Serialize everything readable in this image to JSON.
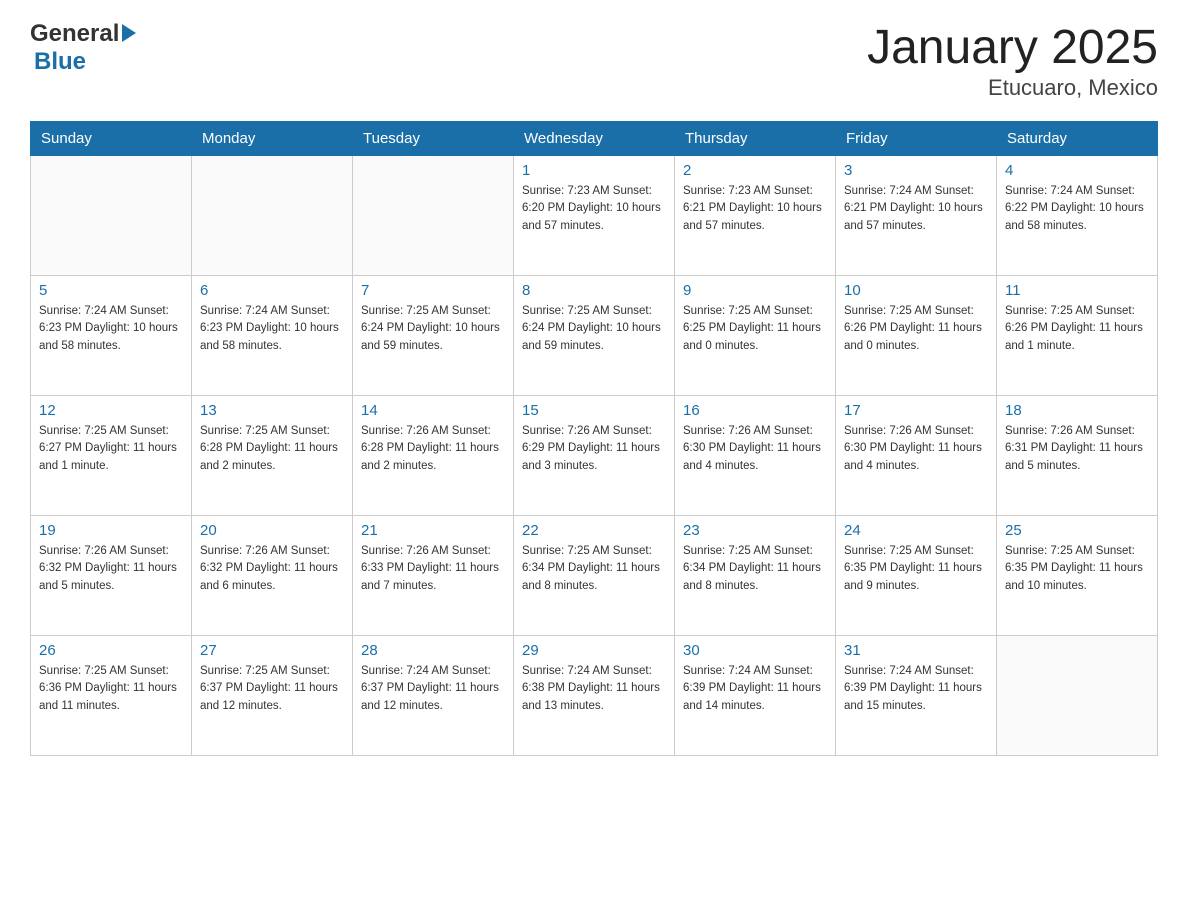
{
  "header": {
    "logo_general": "General",
    "logo_blue": "Blue",
    "title": "January 2025",
    "subtitle": "Etucuaro, Mexico"
  },
  "days_of_week": [
    "Sunday",
    "Monday",
    "Tuesday",
    "Wednesday",
    "Thursday",
    "Friday",
    "Saturday"
  ],
  "weeks": [
    [
      {
        "day": "",
        "info": ""
      },
      {
        "day": "",
        "info": ""
      },
      {
        "day": "",
        "info": ""
      },
      {
        "day": "1",
        "info": "Sunrise: 7:23 AM\nSunset: 6:20 PM\nDaylight: 10 hours and 57 minutes."
      },
      {
        "day": "2",
        "info": "Sunrise: 7:23 AM\nSunset: 6:21 PM\nDaylight: 10 hours and 57 minutes."
      },
      {
        "day": "3",
        "info": "Sunrise: 7:24 AM\nSunset: 6:21 PM\nDaylight: 10 hours and 57 minutes."
      },
      {
        "day": "4",
        "info": "Sunrise: 7:24 AM\nSunset: 6:22 PM\nDaylight: 10 hours and 58 minutes."
      }
    ],
    [
      {
        "day": "5",
        "info": "Sunrise: 7:24 AM\nSunset: 6:23 PM\nDaylight: 10 hours and 58 minutes."
      },
      {
        "day": "6",
        "info": "Sunrise: 7:24 AM\nSunset: 6:23 PM\nDaylight: 10 hours and 58 minutes."
      },
      {
        "day": "7",
        "info": "Sunrise: 7:25 AM\nSunset: 6:24 PM\nDaylight: 10 hours and 59 minutes."
      },
      {
        "day": "8",
        "info": "Sunrise: 7:25 AM\nSunset: 6:24 PM\nDaylight: 10 hours and 59 minutes."
      },
      {
        "day": "9",
        "info": "Sunrise: 7:25 AM\nSunset: 6:25 PM\nDaylight: 11 hours and 0 minutes."
      },
      {
        "day": "10",
        "info": "Sunrise: 7:25 AM\nSunset: 6:26 PM\nDaylight: 11 hours and 0 minutes."
      },
      {
        "day": "11",
        "info": "Sunrise: 7:25 AM\nSunset: 6:26 PM\nDaylight: 11 hours and 1 minute."
      }
    ],
    [
      {
        "day": "12",
        "info": "Sunrise: 7:25 AM\nSunset: 6:27 PM\nDaylight: 11 hours and 1 minute."
      },
      {
        "day": "13",
        "info": "Sunrise: 7:25 AM\nSunset: 6:28 PM\nDaylight: 11 hours and 2 minutes."
      },
      {
        "day": "14",
        "info": "Sunrise: 7:26 AM\nSunset: 6:28 PM\nDaylight: 11 hours and 2 minutes."
      },
      {
        "day": "15",
        "info": "Sunrise: 7:26 AM\nSunset: 6:29 PM\nDaylight: 11 hours and 3 minutes."
      },
      {
        "day": "16",
        "info": "Sunrise: 7:26 AM\nSunset: 6:30 PM\nDaylight: 11 hours and 4 minutes."
      },
      {
        "day": "17",
        "info": "Sunrise: 7:26 AM\nSunset: 6:30 PM\nDaylight: 11 hours and 4 minutes."
      },
      {
        "day": "18",
        "info": "Sunrise: 7:26 AM\nSunset: 6:31 PM\nDaylight: 11 hours and 5 minutes."
      }
    ],
    [
      {
        "day": "19",
        "info": "Sunrise: 7:26 AM\nSunset: 6:32 PM\nDaylight: 11 hours and 5 minutes."
      },
      {
        "day": "20",
        "info": "Sunrise: 7:26 AM\nSunset: 6:32 PM\nDaylight: 11 hours and 6 minutes."
      },
      {
        "day": "21",
        "info": "Sunrise: 7:26 AM\nSunset: 6:33 PM\nDaylight: 11 hours and 7 minutes."
      },
      {
        "day": "22",
        "info": "Sunrise: 7:25 AM\nSunset: 6:34 PM\nDaylight: 11 hours and 8 minutes."
      },
      {
        "day": "23",
        "info": "Sunrise: 7:25 AM\nSunset: 6:34 PM\nDaylight: 11 hours and 8 minutes."
      },
      {
        "day": "24",
        "info": "Sunrise: 7:25 AM\nSunset: 6:35 PM\nDaylight: 11 hours and 9 minutes."
      },
      {
        "day": "25",
        "info": "Sunrise: 7:25 AM\nSunset: 6:35 PM\nDaylight: 11 hours and 10 minutes."
      }
    ],
    [
      {
        "day": "26",
        "info": "Sunrise: 7:25 AM\nSunset: 6:36 PM\nDaylight: 11 hours and 11 minutes."
      },
      {
        "day": "27",
        "info": "Sunrise: 7:25 AM\nSunset: 6:37 PM\nDaylight: 11 hours and 12 minutes."
      },
      {
        "day": "28",
        "info": "Sunrise: 7:24 AM\nSunset: 6:37 PM\nDaylight: 11 hours and 12 minutes."
      },
      {
        "day": "29",
        "info": "Sunrise: 7:24 AM\nSunset: 6:38 PM\nDaylight: 11 hours and 13 minutes."
      },
      {
        "day": "30",
        "info": "Sunrise: 7:24 AM\nSunset: 6:39 PM\nDaylight: 11 hours and 14 minutes."
      },
      {
        "day": "31",
        "info": "Sunrise: 7:24 AM\nSunset: 6:39 PM\nDaylight: 11 hours and 15 minutes."
      },
      {
        "day": "",
        "info": ""
      }
    ]
  ]
}
